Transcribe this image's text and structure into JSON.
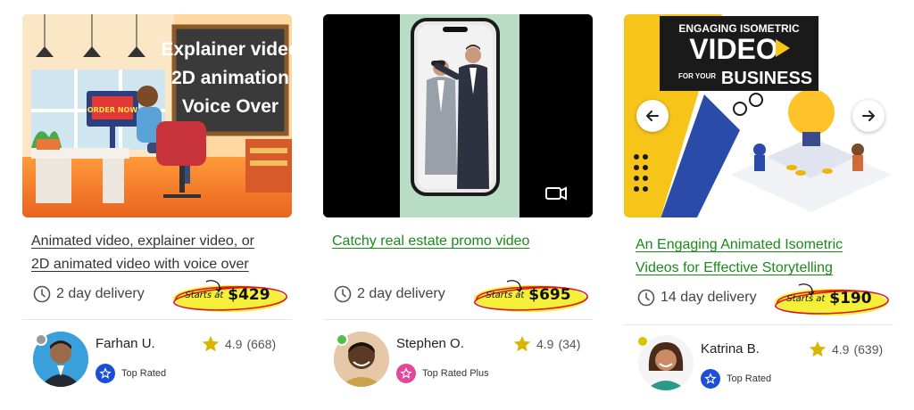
{
  "gigs": [
    {
      "thumb_text": [
        "Explainer video",
        "2D animation",
        "Voice Over"
      ],
      "sign_text": "ORDER NOW",
      "title_lines": [
        "Animated video, explainer video, or",
        "2D animated video with voice over"
      ],
      "delivery": "2 day delivery",
      "price_prefix": "Starts at",
      "price": "$429",
      "seller": "Farhan U.",
      "level": "Top Rated",
      "rating": "4.9",
      "reviews": "(668)",
      "online": false
    },
    {
      "thumb_text": [],
      "title_lines": [
        "Catchy real estate promo video"
      ],
      "delivery": "2 day delivery",
      "price_prefix": "Starts at",
      "price": "$695",
      "seller": "Stephen O.",
      "level": "Top Rated Plus",
      "rating": "4.9",
      "reviews": "(34)",
      "online": true
    },
    {
      "thumb_text": [
        "ENGAGING ISOMETRIC",
        "VIDEO",
        "FOR YOUR",
        "BUSINESS"
      ],
      "title_lines": [
        "An Engaging Animated Isometric",
        "Videos for Effective Storytelling"
      ],
      "delivery": "14 day delivery",
      "price_prefix": "Starts at",
      "price": "$190",
      "seller": "Katrina B.",
      "level": "Top Rated",
      "rating": "4.9",
      "reviews": "(639)",
      "online": "away"
    }
  ],
  "colors": {
    "link_green": "#1a8a1a",
    "title_dark": "#333333",
    "highlight": "#f6ef3a",
    "ring_red": "#e0141e",
    "star": "#d8b600",
    "top_rated_blue": "#1d4ed8",
    "top_rated_plus_pink": "#e3479a",
    "online_green": "#4fc04f",
    "offline_gray": "#9a9a9a",
    "away_yellow": "#d9c400"
  },
  "icons": [
    "clock-icon",
    "star-icon",
    "badge-icon",
    "video-camera-icon",
    "arrow-left-icon",
    "arrow-right-icon"
  ]
}
